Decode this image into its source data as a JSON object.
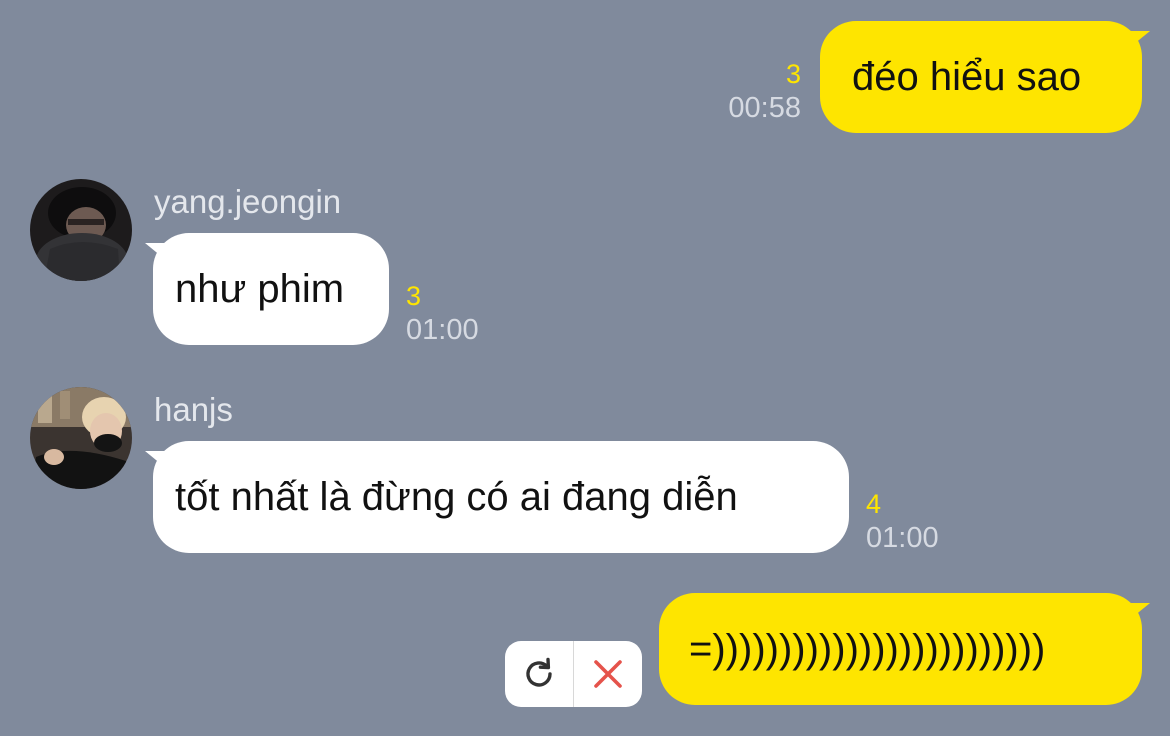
{
  "messages": [
    {
      "text": "đéo hiểu sao",
      "unread": "3",
      "time": "00:58"
    },
    {
      "sender": "yang.jeongin",
      "text": "như phim",
      "unread": "3",
      "time": "01:00"
    },
    {
      "sender": "hanjs",
      "text": "tốt nhất là đừng có ai đang diễn",
      "unread": "4",
      "time": "01:00"
    },
    {
      "text": "=)))))))))))))))))))))))))"
    }
  ],
  "failed_actions": {
    "retry_icon": "retry-icon",
    "delete_icon": "close-icon"
  },
  "colors": {
    "background": "#808a9c",
    "outgoing_bubble": "#fee500",
    "incoming_bubble": "#ffffff",
    "unread": "#fee500",
    "delete": "#e5534b"
  }
}
